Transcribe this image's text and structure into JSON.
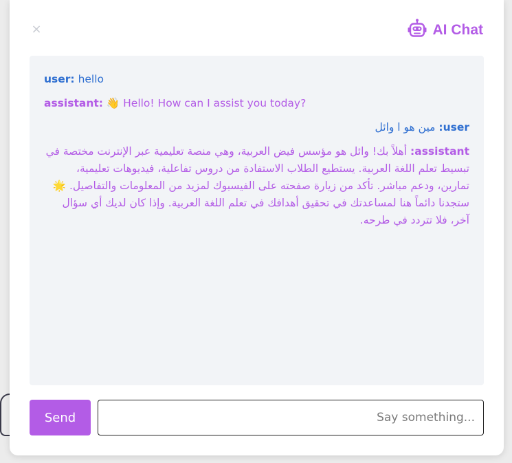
{
  "header": {
    "title": "AI Chat",
    "close_label": "×",
    "icon": "robot-icon",
    "brand_color": "#b35ce6"
  },
  "messages": [
    {
      "role_label": "user:",
      "text": "hello",
      "dir": "ltr",
      "type": "user"
    },
    {
      "role_label": "assistant:",
      "text": "👋 Hello! How can I assist you today?",
      "dir": "ltr",
      "type": "assistant"
    },
    {
      "role_label": "user:",
      "text": "مين هو ا وائل",
      "dir": "rtl",
      "type": "user"
    },
    {
      "role_label": "assistant:",
      "text": "أهلاً بك! وائل هو مؤسس فيض العربية، وهي منصة تعليمية عبر الإنترنت مختصة في تبسيط تعلم اللغة العربية. يستطيع الطلاب الاستفادة من دروس تفاعلية، فيديوهات تعليمية، تمارين، ودعم مباشر. تأكد من زيارة صفحته على الفيسبوك لمزيد من المعلومات والتفاصيل. 🌟 ستجدنا دائماً هنا لمساعدتك في تحقيق أهدافك في تعلم اللغة العربية. وإذا كان لديك أي سؤال آخر، فلا تتردد في طرحه.",
      "dir": "rtl",
      "type": "assistant"
    }
  ],
  "composer": {
    "send_label": "Send",
    "placeholder": "...Say something",
    "value": ""
  },
  "colors": {
    "user": "#2f6fd1",
    "assistant": "#b35ce6",
    "messages_bg": "#f2f4f7"
  }
}
